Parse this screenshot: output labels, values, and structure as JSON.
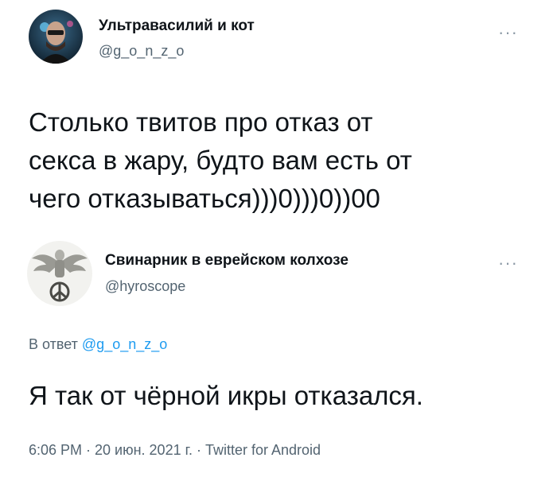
{
  "tweet1": {
    "avatar_icon": "user-avatar",
    "name": "Ультравасилий и кот",
    "handle": "@g_o_n_z_o",
    "more_icon": "more-horizontal-icon",
    "more_label": "···",
    "text_lines": [
      "Столько твитов про отказ от",
      "секса в жару, будто вам есть от",
      "чего отказываться)))0)))0))00"
    ]
  },
  "tweet2": {
    "avatar_icon": "user-avatar-emblem",
    "name": "Свинарник в еврейском колхозе",
    "handle": "@hyroscope",
    "more_icon": "more-horizontal-icon",
    "more_label": "···",
    "reply_prefix": "В ответ",
    "reply_handle": "@g_o_n_z_o",
    "text": "Я так от чёрной икры отказался.",
    "meta": "6:06 PM · 20 июн. 2021 г. · Twitter for Android"
  },
  "colors": {
    "text": "#0f1419",
    "secondary": "#536471",
    "link": "#1d9bf0"
  }
}
